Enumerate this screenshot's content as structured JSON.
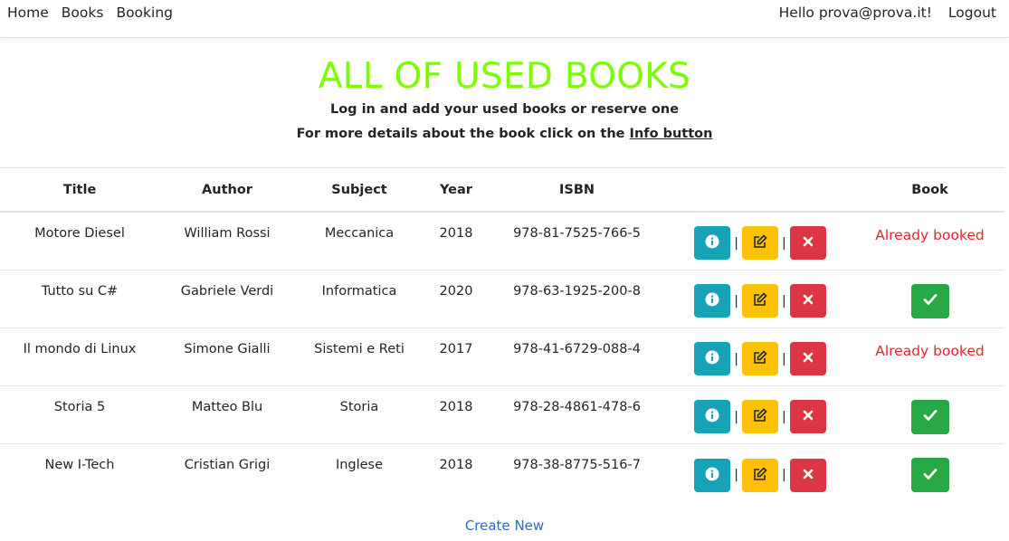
{
  "nav": {
    "home": "Home",
    "books": "Books",
    "booking": "Booking",
    "greeting": "Hello prova@prova.it!",
    "logout": "Logout"
  },
  "header": {
    "title": "ALL OF USED BOOKS",
    "subtitle1": "Log in and add your used books or reserve one",
    "subtitle2_prefix": "For more details about the book click on the ",
    "subtitle2_link": "Info button"
  },
  "table": {
    "columns": [
      "Title",
      "Author",
      "Subject",
      "Year",
      "ISBN",
      "",
      "Book"
    ],
    "rows": [
      {
        "title": "Motore Diesel",
        "author": "William Rossi",
        "subject": "Meccanica",
        "year": "2018",
        "isbn": "978-81-7525-766-5",
        "status": "Already booked",
        "booked": true
      },
      {
        "title": "Tutto su C#",
        "author": "Gabriele Verdi",
        "subject": "Informatica",
        "year": "2020",
        "isbn": "978-63-1925-200-8",
        "status": "",
        "booked": false
      },
      {
        "title": "Il mondo di Linux",
        "author": "Simone Gialli",
        "subject": "Sistemi e Reti",
        "year": "2017",
        "isbn": "978-41-6729-088-4",
        "status": "Already booked",
        "booked": true
      },
      {
        "title": "Storia 5",
        "author": "Matteo Blu",
        "subject": "Storia",
        "year": "2018",
        "isbn": "978-28-4861-478-6",
        "status": "",
        "booked": false
      },
      {
        "title": "New I-Tech",
        "author": "Cristian Grigi",
        "subject": "Inglese",
        "year": "2018",
        "isbn": "978-38-8775-516-7",
        "status": "",
        "booked": false
      }
    ],
    "separator": "|"
  },
  "footer": {
    "create_new": "Create New"
  },
  "colors": {
    "title": "#7cfc00",
    "booked_text": "#e3262c",
    "link": "#2e6ac9",
    "info": "#17a2b8",
    "warning": "#ffc107",
    "danger": "#dc3545",
    "success": "#28a745"
  },
  "icons": {
    "info": "info-circle-icon",
    "edit": "edit-icon",
    "delete": "close-icon",
    "book": "check-icon"
  }
}
